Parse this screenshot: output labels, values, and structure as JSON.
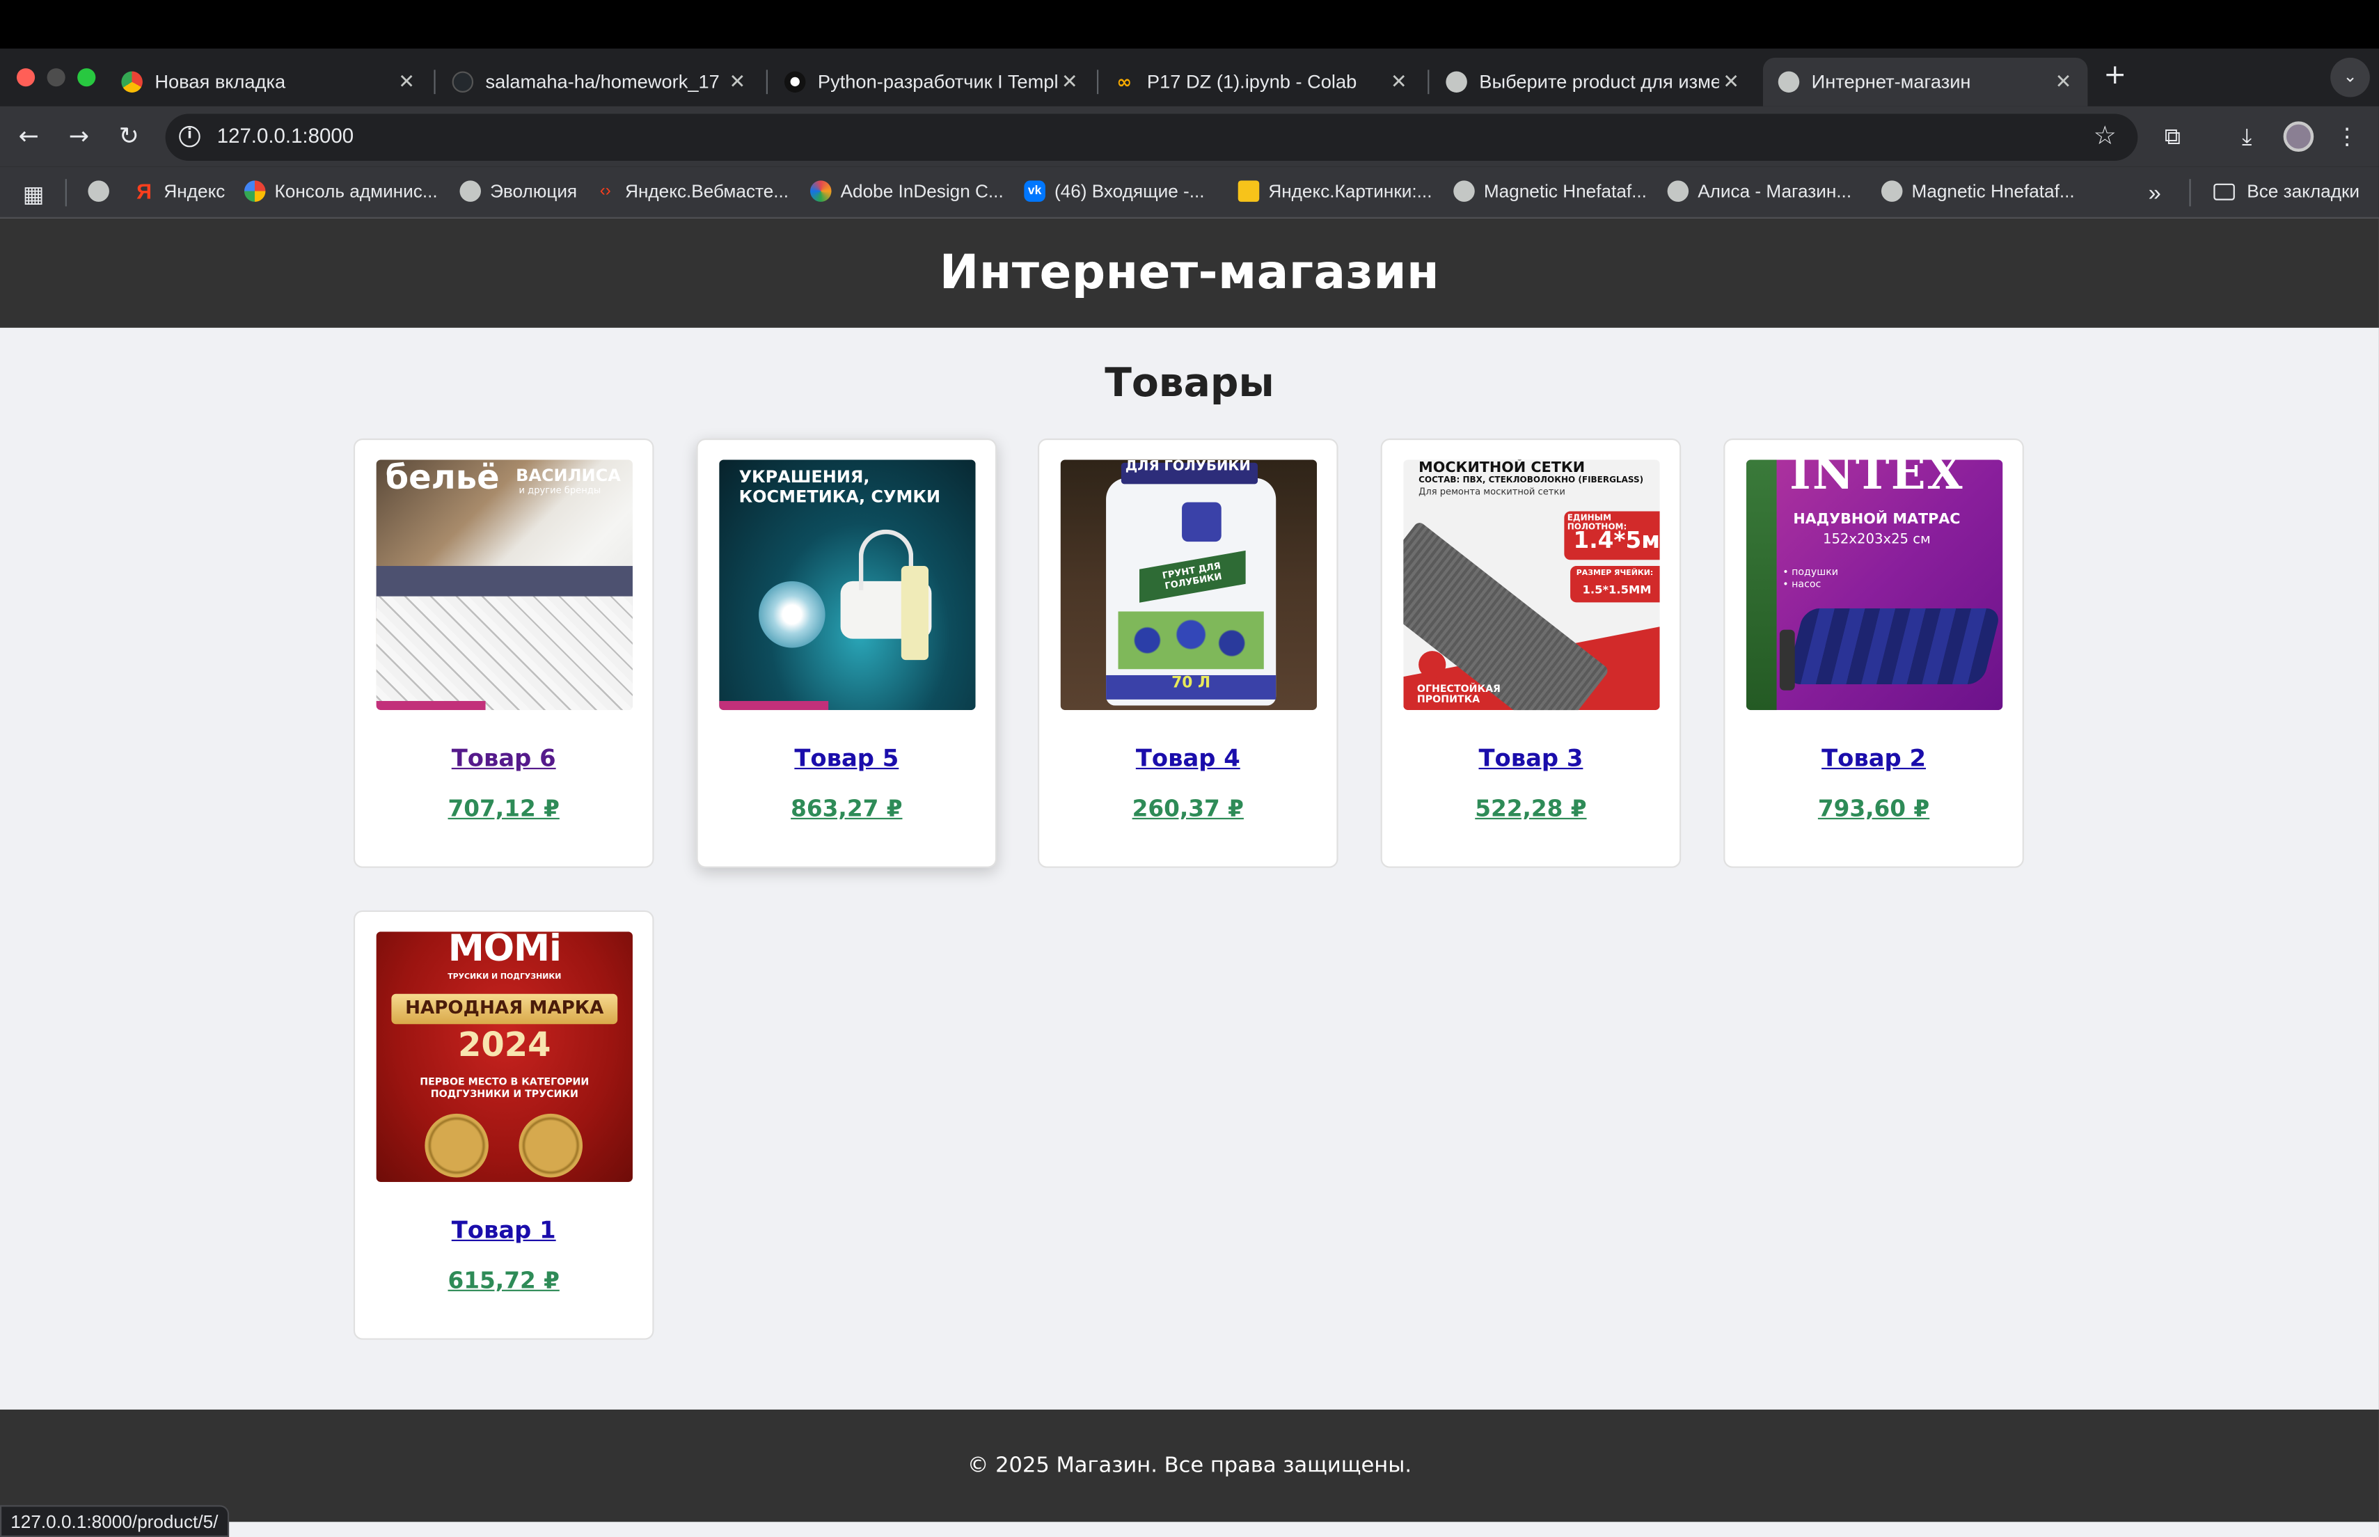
{
  "browser": {
    "tabs": [
      {
        "title": "Новая вкладка",
        "favicon": "chrome-icon"
      },
      {
        "title": "salamaha-ha/homework_17",
        "favicon": "github-icon"
      },
      {
        "title": "Python-разработчик I Templ",
        "favicon": "skypro-icon"
      },
      {
        "title": "P17 DZ (1).ipynb - Colab",
        "favicon": "colab-icon"
      },
      {
        "title": "Выберите product для изме",
        "favicon": "globe-icon"
      },
      {
        "title": "Интернет-магазин",
        "favicon": "globe-icon"
      }
    ],
    "new_tab": "+",
    "url": "127.0.0.1:8000",
    "bookmarks": [
      {
        "label": "Яндекс"
      },
      {
        "label": "Консоль админис..."
      },
      {
        "label": "Эволюция"
      },
      {
        "label": "Яндекс.Вебмасте..."
      },
      {
        "label": "Adobe InDesign C..."
      },
      {
        "label": "(46) Входящие -..."
      },
      {
        "label": "Яндекс.Картинки:..."
      },
      {
        "label": "Magnetic Hnefataf..."
      },
      {
        "label": "Алиса - Магазин..."
      },
      {
        "label": "Magnetic Hnefataf..."
      }
    ],
    "all_bookmarks": "Все закладки",
    "status_url": "127.0.0.1:8000/product/5/"
  },
  "site": {
    "header_title": "Интернет-магазин",
    "section_title": "Товары",
    "footer_text": "© 2025 Магазин. Все права защищены."
  },
  "products": [
    {
      "name": "Товар 6",
      "price": "707,12 ₽",
      "image": {
        "headline": "бельё",
        "sub": "ВАСИЛИСА",
        "sub2": "и другие бренды"
      }
    },
    {
      "name": "Товар 5",
      "price": "863,27 ₽",
      "image": {
        "headline": "УКРАШЕНИЯ,",
        "sub": "КОСМЕТИКА, СУМКИ"
      }
    },
    {
      "name": "Товар 4",
      "price": "260,37 ₽",
      "image": {
        "headline": "ДЛЯ ГОЛУБИКИ",
        "sub": "ГРУНТ ДЛЯ ГОЛУБИКИ",
        "sub2": "70 Л"
      }
    },
    {
      "name": "Товар 3",
      "price": "522,28 ₽",
      "image": {
        "headline": "МОСКИТНОЙ СЕТКИ",
        "sub": "СОСТАВ: ПВХ, СТЕКЛОВОЛОКНО (FIBERGLASS)",
        "sub2": "Для ремонта москитной сетки",
        "badge1": "ЕДИНЫМ ПОЛОТНОМ:",
        "badge1_val": "1.4*5м",
        "badge2": "РАЗМЕР ЯЧЕЙКИ:",
        "badge2_val": "1.5*1.5ММ",
        "footer": "ОГНЕСТОЙКАЯ ПРОПИТКА"
      }
    },
    {
      "name": "Товар 2",
      "price": "793,60 ₽",
      "image": {
        "headline": "INTEX",
        "sub": "НАДУВНОЙ МАТРАС",
        "sub2": "152x203x25 см",
        "bullets": "• подушки\n• насос"
      }
    },
    {
      "name": "Товар 1",
      "price": "615,72 ₽",
      "image": {
        "headline": "MOMi",
        "sub": "ТРУСИКИ И ПОДГУЗНИКИ",
        "badge": "НАРОДНАЯ МАРКА",
        "year": "2024",
        "caption": "ПЕРВОЕ МЕСТО В КАТЕГОРИИ ПОДГУЗНИКИ И ТРУСИКИ"
      }
    }
  ],
  "colors": {
    "header_bg": "#333333",
    "page_bg": "#f0f1f4",
    "link": "#1a0dab",
    "visited_link": "#551a8b",
    "price": "#2e8b57"
  }
}
